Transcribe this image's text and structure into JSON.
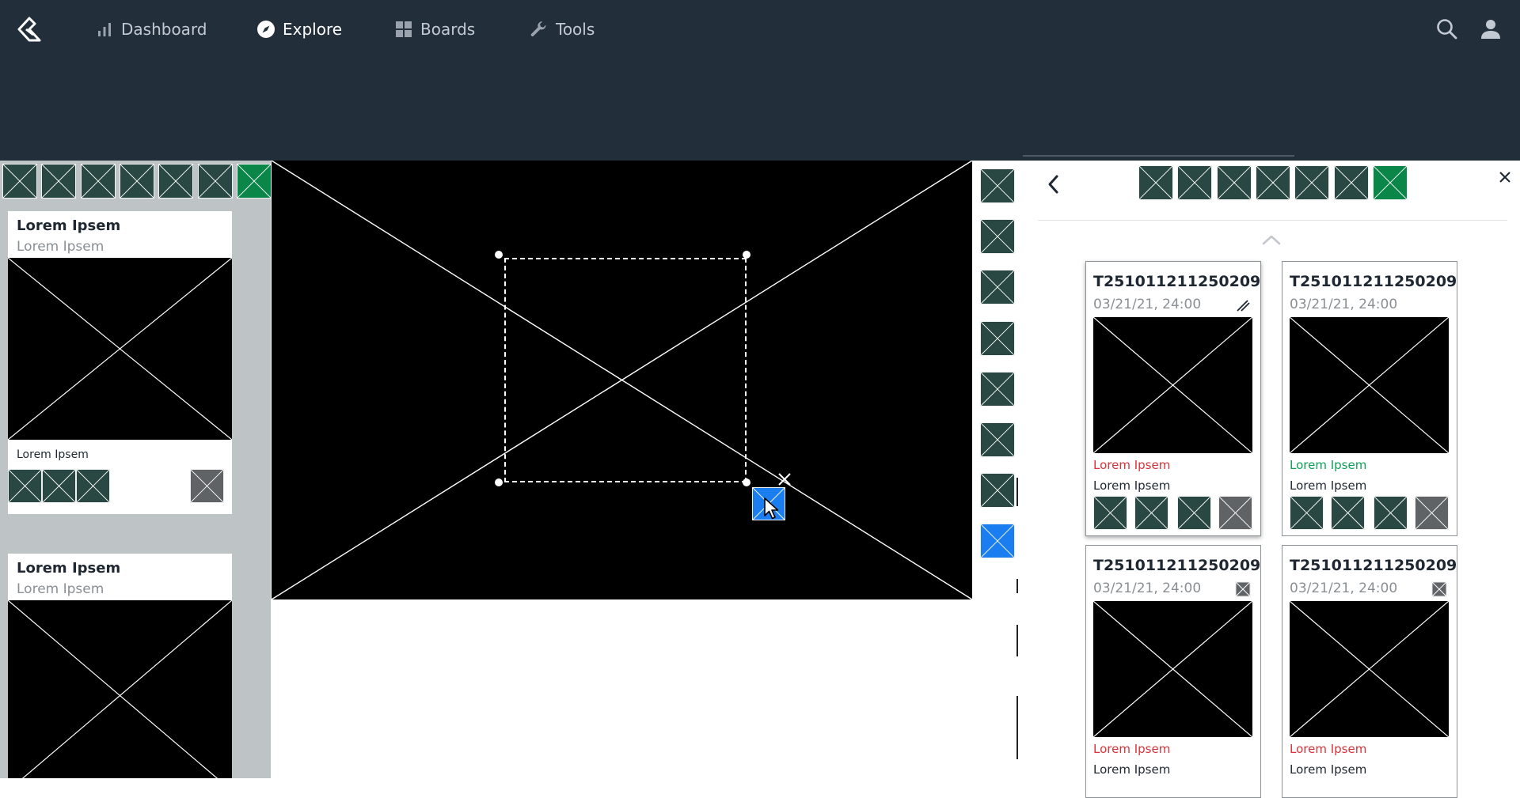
{
  "nav": {
    "logo": "app-logo",
    "items": [
      {
        "label": "Dashboard",
        "icon": "bar-chart-icon"
      },
      {
        "label": "Explore",
        "icon": "compass-icon"
      },
      {
        "label": "Boards",
        "icon": "grid-icon"
      },
      {
        "label": "Tools",
        "icon": "wrench-icon"
      }
    ],
    "active": "Explore",
    "right_icons": [
      "search-icon",
      "user-icon"
    ]
  },
  "left_panel": {
    "cards": [
      {
        "title": "Lorem Ipsem",
        "subtitle": "Lorem Ipsem",
        "caption": "Lorem Ipsem"
      },
      {
        "title": "Lorem Ipsem",
        "subtitle": "Lorem Ipsem"
      }
    ]
  },
  "results": [
    {
      "id": "T251011211250209",
      "date": "03/21/21, 24:00",
      "status": "Lorem Ipsem",
      "status_color": "#d6333a",
      "label": "Lorem Ipsem",
      "action_icon": "edit-icon"
    },
    {
      "id": "T251011211250209",
      "date": "03/21/21, 24:00",
      "status": "Lorem Ipsem",
      "status_color": "#0fa058",
      "label": "Lorem Ipsem"
    },
    {
      "id": "T251011211250209",
      "date": "03/21/21, 24:00",
      "status": "Lorem Ipsem",
      "status_color": "#d6333a",
      "label": "Lorem Ipsem",
      "action_icon": "image-icon"
    },
    {
      "id": "T251011211250209",
      "date": "03/21/21, 24:00",
      "status": "Lorem Ipsem",
      "status_color": "#d6333a",
      "label": "Lorem Ipsem",
      "action_icon": "image-icon"
    }
  ],
  "colors": {
    "topbar": "#232e3b",
    "tile": "#294843",
    "tile_active": "#0a8649",
    "tile_selected": "#1b7ef0",
    "panel": "#bec3c6"
  }
}
